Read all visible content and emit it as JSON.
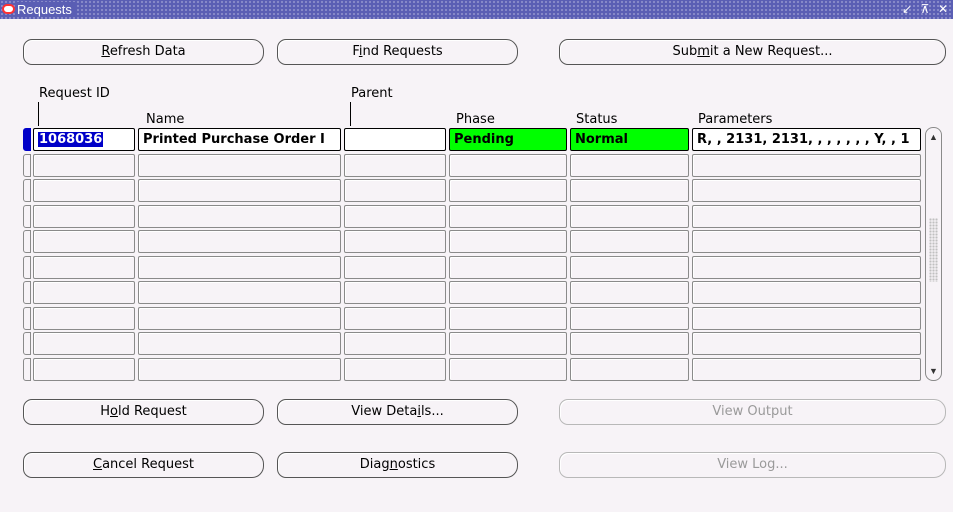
{
  "window": {
    "title": "Requests",
    "controls": [
      "↙",
      "⊼",
      "✕"
    ]
  },
  "top_buttons": {
    "refresh": {
      "pre": "",
      "key": "R",
      "post": "efresh Data"
    },
    "find": {
      "pre": "F",
      "key": "i",
      "post": "nd Requests"
    },
    "submit": {
      "pre": "Sub",
      "key": "m",
      "post": "it a New Request..."
    }
  },
  "columns": {
    "request_id": "Request ID",
    "name": "Name",
    "parent": "Parent",
    "phase": "Phase",
    "status": "Status",
    "parameters": "Parameters"
  },
  "rows": [
    {
      "request_id": "1068036",
      "name": "Printed Purchase Order I",
      "parent": "",
      "phase": "Pending",
      "status": "Normal",
      "parameters": "R, , 2131, 2131, , , , , , , Y, , 1"
    }
  ],
  "colors": {
    "pending_phase": "#00ff00",
    "normal_status": "#00ff00",
    "selection": "#0000c8",
    "title_bar": "#5a5eb4"
  },
  "bottom_buttons": {
    "hold": {
      "pre": "H",
      "key": "o",
      "post": "ld Request"
    },
    "view_details": {
      "pre": "View Deta",
      "key": "i",
      "post": "ls..."
    },
    "view_output": "View Output",
    "cancel": {
      "pre": "",
      "key": "C",
      "post": "ancel Request"
    },
    "diagnostics": {
      "pre": "Diag",
      "key": "n",
      "post": "ostics"
    },
    "view_log": "View Log..."
  }
}
